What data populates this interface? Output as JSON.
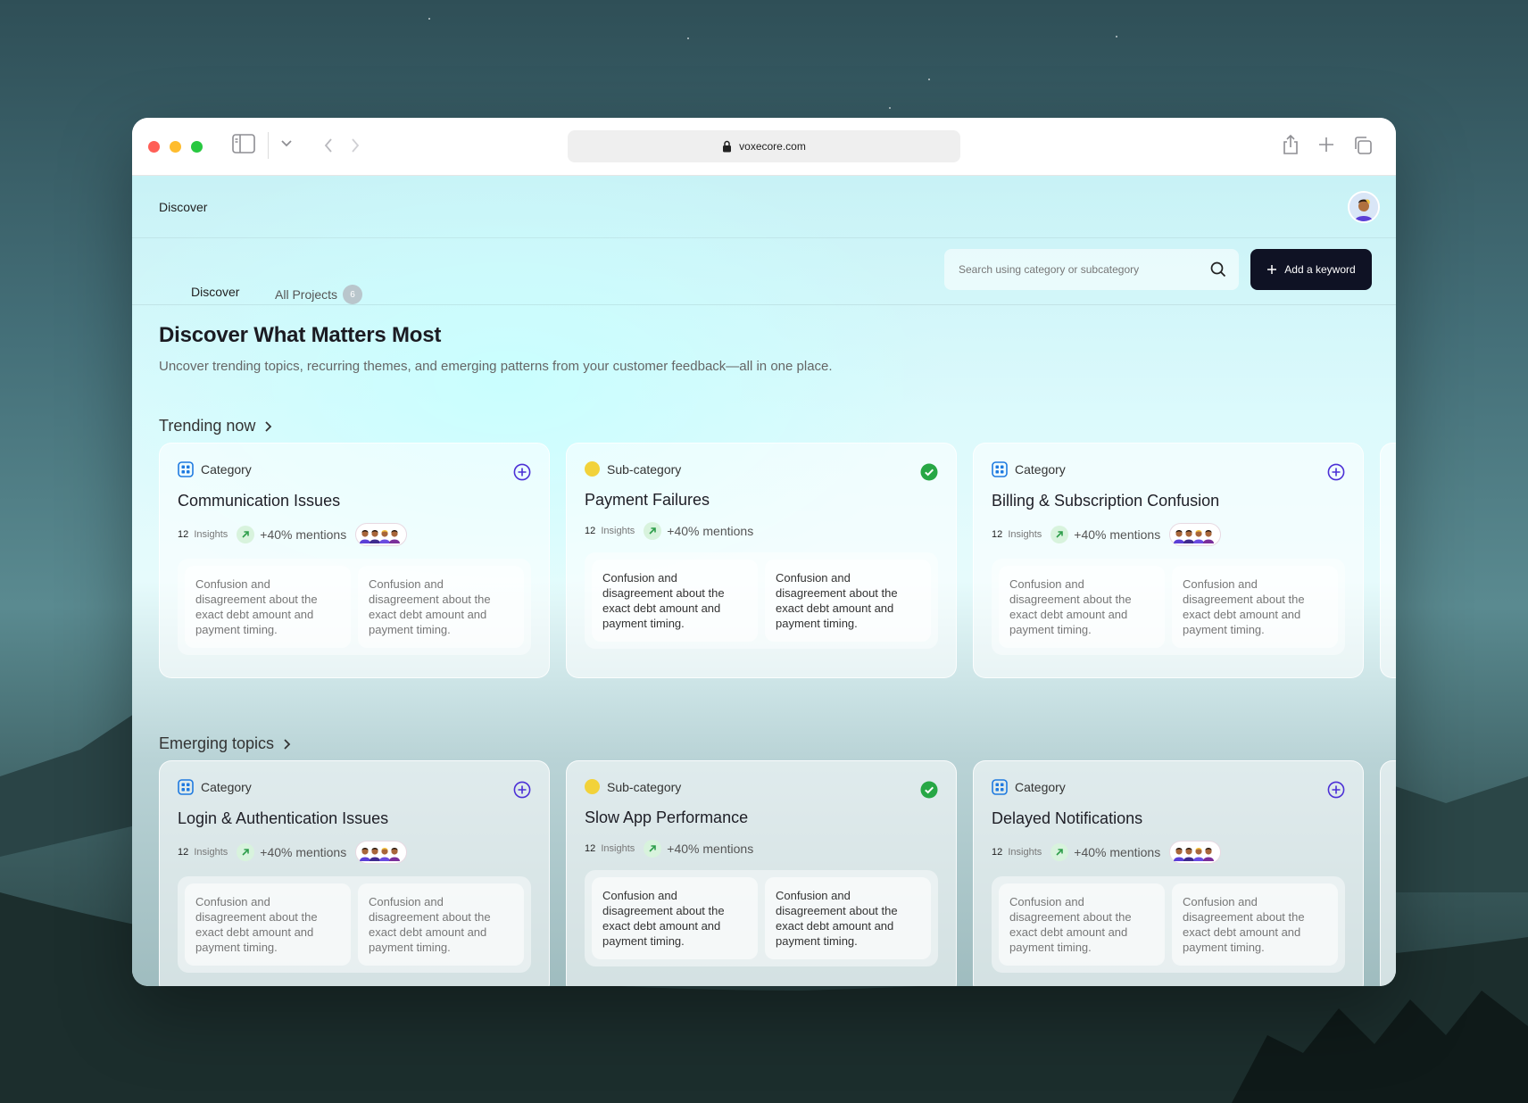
{
  "browser": {
    "url": "voxecore.com"
  },
  "topbar": {
    "breadcrumb": "Discover"
  },
  "tabs": [
    {
      "label": "Discover"
    },
    {
      "label": "All Projects",
      "count": "6"
    }
  ],
  "search": {
    "placeholder": "Search using category or subcategory"
  },
  "add_button": {
    "label": "Add a keyword"
  },
  "hero": {
    "title": "Discover What Matters Most",
    "subtitle": "Uncover trending topics, recurring themes, and emerging patterns from your customer feedback—all in one place."
  },
  "sections": [
    {
      "title": "Trending now",
      "cards": [
        {
          "type": "Category",
          "title": "Communication Issues",
          "insights_count": "12",
          "insights_label": "Insights",
          "mentions": "+40% mentions",
          "status": "add",
          "insights": [
            "Confusion and disagreement about the exact debt amount and payment timing.",
            "Confusion and disagreement about the exact debt amount and payment timing."
          ]
        },
        {
          "type": "Sub-category",
          "title": "Payment Failures",
          "insights_count": "12",
          "insights_label": "Insights",
          "mentions": "+40% mentions",
          "status": "added",
          "insights": [
            "Confusion and disagreement about the exact debt amount and payment timing.",
            "Confusion and disagreement about the exact debt amount and payment timing."
          ]
        },
        {
          "type": "Category",
          "title": "Billing & Subscription Confusion",
          "insights_count": "12",
          "insights_label": "Insights",
          "mentions": "+40% mentions",
          "status": "add",
          "insights": [
            "Confusion and disagreement about the exact debt amount and payment timing.",
            "Confusion and disagreement about the exact debt amount and payment timing."
          ]
        }
      ]
    },
    {
      "title": "Emerging topics",
      "cards": [
        {
          "type": "Category",
          "title": "Login & Authentication Issues",
          "insights_count": "12",
          "insights_label": "Insights",
          "mentions": "+40% mentions",
          "status": "add",
          "insights": [
            "Confusion and disagreement about the exact debt amount and payment timing.",
            "Confusion and disagreement about the exact debt amount and payment timing."
          ]
        },
        {
          "type": "Sub-category",
          "title": "Slow App Performance",
          "insights_count": "12",
          "insights_label": "Insights",
          "mentions": "+40% mentions",
          "status": "added",
          "insights": [
            "Confusion and disagreement about the exact debt amount and payment timing.",
            "Confusion and disagreement about the exact debt amount and payment timing."
          ]
        },
        {
          "type": "Category",
          "title": "Delayed Notifications",
          "insights_count": "12",
          "insights_label": "Insights",
          "mentions": "+40% mentions",
          "status": "add",
          "insights": [
            "Confusion and disagreement about the exact debt amount and payment timing.",
            "Confusion and disagreement about the exact debt amount and payment timing."
          ]
        }
      ]
    }
  ],
  "colors": {
    "accent": "#4b2fd6",
    "category_icon": "#1f7ae0",
    "added_green": "#27a745",
    "trend_green": "#2e9e4b",
    "button_dark": "#0f1224"
  },
  "icons": {
    "category": "grid-icon",
    "sub_category": "yellow-dot-icon",
    "add": "plus-circle-icon",
    "added": "check-circle-icon",
    "trend": "arrow-up-right-icon"
  }
}
